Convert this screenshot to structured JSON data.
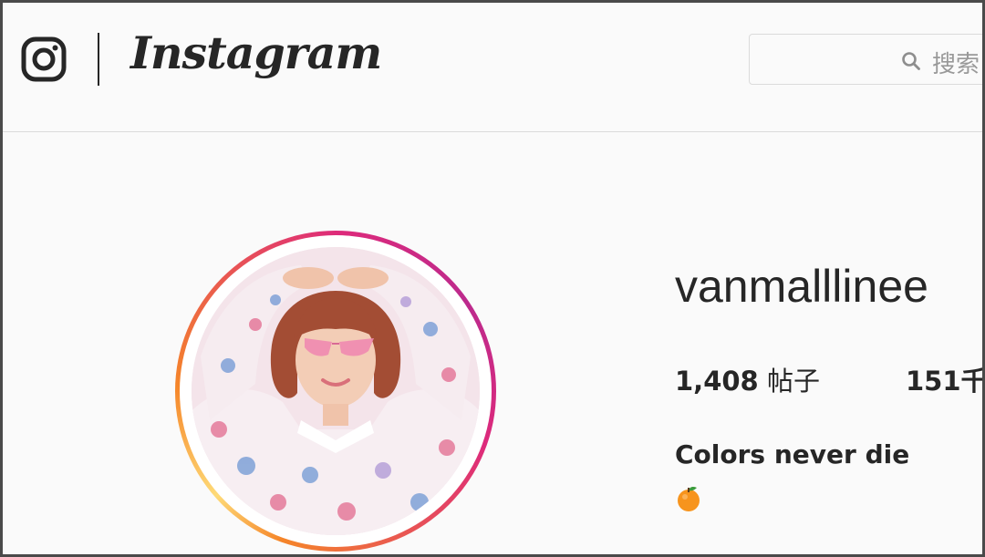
{
  "header": {
    "logo_icon": "instagram-camera-icon",
    "wordmark": "Instagram",
    "search": {
      "icon": "search-icon",
      "placeholder": "搜索"
    }
  },
  "profile": {
    "avatar": "profile-photo",
    "avatar_ring_colors": [
      "#f58529",
      "#dd2a7b",
      "#bc2a8d"
    ],
    "username": "vanmalllinee",
    "stats": [
      {
        "value": "1,408",
        "label": "帖子"
      },
      {
        "value": "151千",
        "label": ""
      }
    ],
    "bio_name": "Colors never die",
    "bio_emoji": "orange-emoji"
  }
}
